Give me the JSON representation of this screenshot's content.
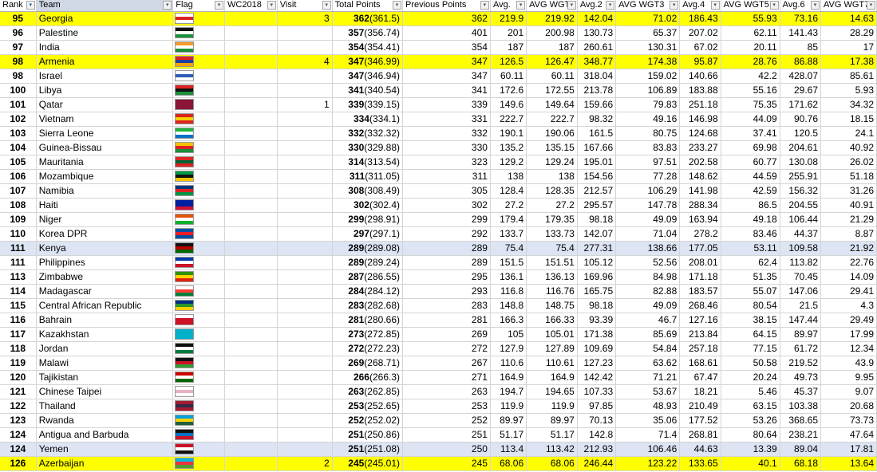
{
  "headers": {
    "rank": "Rank",
    "team": "Team",
    "flag": "Flag",
    "wc2018": "WC2018",
    "visit": "Visit",
    "total": "Total Points",
    "prev": "Previous Points",
    "avg": "Avg.",
    "avg_wgt": "AVG WGT",
    "avg2": "Avg.2",
    "avg_wgt3": "AVG WGT3",
    "avg4": "Avg.4",
    "avg_wgt5": "AVG WGT5",
    "avg6": "Avg.6",
    "avg_wgt7": "AVG WGT7"
  },
  "rows": [
    {
      "rank": "95",
      "team": "Georgia",
      "visit": "3",
      "tp": "362",
      "tpd": "(361.5)",
      "prev": "362",
      "avg": "219.9",
      "avg_wgt": "219.92",
      "avg2": "142.04",
      "avg_wgt3": "71.02",
      "avg4": "186.43",
      "avg_wgt5": "55.93",
      "avg6": "73.16",
      "avg_wgt7": "14.63",
      "style": "hl",
      "flag": [
        "#ffffff",
        "#d22",
        "#ffffff"
      ]
    },
    {
      "rank": "96",
      "team": "Palestine",
      "visit": "",
      "tp": "357",
      "tpd": "(356.74)",
      "prev": "401",
      "avg": "201",
      "avg_wgt": "200.98",
      "avg2": "130.73",
      "avg_wgt3": "65.37",
      "avg4": "207.02",
      "avg_wgt5": "62.11",
      "avg6": "141.43",
      "avg_wgt7": "28.29",
      "style": "",
      "flag": [
        "#111",
        "#fff",
        "#1a8f3a"
      ]
    },
    {
      "rank": "97",
      "team": "India",
      "visit": "",
      "tp": "354",
      "tpd": "(354.41)",
      "prev": "354",
      "avg": "187",
      "avg_wgt": "187",
      "avg2": "260.61",
      "avg_wgt3": "130.31",
      "avg4": "67.02",
      "avg_wgt5": "20.11",
      "avg6": "85",
      "avg_wgt7": "17",
      "style": "",
      "flag": [
        "#f59a2b",
        "#fff",
        "#1a8f3a"
      ]
    },
    {
      "rank": "98",
      "team": "Armenia",
      "visit": "4",
      "tp": "347",
      "tpd": "(346.99)",
      "prev": "347",
      "avg": "126.5",
      "avg_wgt": "126.47",
      "avg2": "348.77",
      "avg_wgt3": "174.38",
      "avg4": "95.87",
      "avg_wgt5": "28.76",
      "avg6": "86.88",
      "avg_wgt7": "17.38",
      "style": "hl",
      "flag": [
        "#d22",
        "#1f3fa0",
        "#f4a300"
      ]
    },
    {
      "rank": "98",
      "team": "Israel",
      "visit": "",
      "tp": "347",
      "tpd": "(346.94)",
      "prev": "347",
      "avg": "60.11",
      "avg_wgt": "60.11",
      "avg2": "318.04",
      "avg_wgt3": "159.02",
      "avg4": "140.66",
      "avg_wgt5": "42.2",
      "avg6": "428.07",
      "avg_wgt7": "85.61",
      "style": "",
      "flag": [
        "#fff",
        "#2d5bb9",
        "#fff"
      ]
    },
    {
      "rank": "100",
      "team": "Libya",
      "visit": "",
      "tp": "341",
      "tpd": "(340.54)",
      "prev": "341",
      "avg": "172.6",
      "avg_wgt": "172.55",
      "avg2": "213.78",
      "avg_wgt3": "106.89",
      "avg4": "183.88",
      "avg_wgt5": "55.16",
      "avg6": "29.67",
      "avg_wgt7": "5.93",
      "style": "",
      "flag": [
        "#d22",
        "#111",
        "#1a8f3a"
      ]
    },
    {
      "rank": "101",
      "team": "Qatar",
      "visit": "1",
      "tp": "339",
      "tpd": "(339.15)",
      "prev": "339",
      "avg": "149.6",
      "avg_wgt": "149.64",
      "avg2": "159.66",
      "avg_wgt3": "79.83",
      "avg4": "251.18",
      "avg_wgt5": "75.35",
      "avg6": "171.62",
      "avg_wgt7": "34.32",
      "style": "",
      "flag": [
        "#8a1538",
        "#8a1538",
        "#8a1538"
      ]
    },
    {
      "rank": "102",
      "team": "Vietnam",
      "visit": "",
      "tp": "334",
      "tpd": "(334.1)",
      "prev": "331",
      "avg": "222.7",
      "avg_wgt": "222.7",
      "avg2": "98.32",
      "avg_wgt3": "49.16",
      "avg4": "146.98",
      "avg_wgt5": "44.09",
      "avg6": "90.76",
      "avg_wgt7": "18.15",
      "style": "",
      "flag": [
        "#da251d",
        "#f5d000",
        "#da251d"
      ]
    },
    {
      "rank": "103",
      "team": "Sierra Leone",
      "visit": "",
      "tp": "332",
      "tpd": "(332.32)",
      "prev": "332",
      "avg": "190.1",
      "avg_wgt": "190.06",
      "avg2": "161.5",
      "avg_wgt3": "80.75",
      "avg4": "124.68",
      "avg_wgt5": "37.41",
      "avg6": "120.5",
      "avg_wgt7": "24.1",
      "style": "",
      "flag": [
        "#1eb53a",
        "#fff",
        "#0072c6"
      ]
    },
    {
      "rank": "104",
      "team": "Guinea-Bissau",
      "visit": "",
      "tp": "330",
      "tpd": "(329.88)",
      "prev": "330",
      "avg": "135.2",
      "avg_wgt": "135.15",
      "avg2": "167.66",
      "avg_wgt3": "83.83",
      "avg4": "233.27",
      "avg_wgt5": "69.98",
      "avg6": "204.61",
      "avg_wgt7": "40.92",
      "style": "",
      "flag": [
        "#f4c300",
        "#d22",
        "#1a8f3a"
      ]
    },
    {
      "rank": "105",
      "team": "Mauritania",
      "visit": "",
      "tp": "314",
      "tpd": "(313.54)",
      "prev": "323",
      "avg": "129.2",
      "avg_wgt": "129.24",
      "avg2": "195.01",
      "avg_wgt3": "97.51",
      "avg4": "202.58",
      "avg_wgt5": "60.77",
      "avg6": "130.08",
      "avg_wgt7": "26.02",
      "style": "",
      "flag": [
        "#d22",
        "#006233",
        "#d22"
      ]
    },
    {
      "rank": "106",
      "team": "Mozambique",
      "visit": "",
      "tp": "311",
      "tpd": "(311.05)",
      "prev": "311",
      "avg": "138",
      "avg_wgt": "138",
      "avg2": "154.56",
      "avg_wgt3": "77.28",
      "avg4": "148.62",
      "avg_wgt5": "44.59",
      "avg6": "255.91",
      "avg_wgt7": "51.18",
      "style": "",
      "flag": [
        "#009a44",
        "#111",
        "#f4c300"
      ]
    },
    {
      "rank": "107",
      "team": "Namibia",
      "visit": "",
      "tp": "308",
      "tpd": "(308.49)",
      "prev": "305",
      "avg": "128.4",
      "avg_wgt": "128.35",
      "avg2": "212.57",
      "avg_wgt3": "106.29",
      "avg4": "141.98",
      "avg_wgt5": "42.59",
      "avg6": "156.32",
      "avg_wgt7": "31.26",
      "style": "",
      "flag": [
        "#003580",
        "#d22",
        "#009543"
      ]
    },
    {
      "rank": "108",
      "team": "Haiti",
      "visit": "",
      "tp": "302",
      "tpd": "(302.4)",
      "prev": "302",
      "avg": "27.2",
      "avg_wgt": "27.2",
      "avg2": "295.57",
      "avg_wgt3": "147.78",
      "avg4": "288.34",
      "avg_wgt5": "86.5",
      "avg6": "204.55",
      "avg_wgt7": "40.91",
      "style": "",
      "flag": [
        "#00209f",
        "#00209f",
        "#d21034"
      ]
    },
    {
      "rank": "109",
      "team": "Niger",
      "visit": "",
      "tp": "299",
      "tpd": "(298.91)",
      "prev": "299",
      "avg": "179.4",
      "avg_wgt": "179.35",
      "avg2": "98.18",
      "avg_wgt3": "49.09",
      "avg4": "163.94",
      "avg_wgt5": "49.18",
      "avg6": "106.44",
      "avg_wgt7": "21.29",
      "style": "",
      "flag": [
        "#e05206",
        "#fff",
        "#0db02b"
      ]
    },
    {
      "rank": "110",
      "team": "Korea DPR",
      "visit": "",
      "tp": "297",
      "tpd": "(297.1)",
      "prev": "292",
      "avg": "133.7",
      "avg_wgt": "133.73",
      "avg2": "142.07",
      "avg_wgt3": "71.04",
      "avg4": "278.2",
      "avg_wgt5": "83.46",
      "avg6": "44.37",
      "avg_wgt7": "8.87",
      "style": "",
      "flag": [
        "#024fa2",
        "#ed1c27",
        "#024fa2"
      ]
    },
    {
      "rank": "111",
      "team": "Kenya",
      "visit": "",
      "tp": "289",
      "tpd": "(289.08)",
      "prev": "289",
      "avg": "75.4",
      "avg_wgt": "75.4",
      "avg2": "277.31",
      "avg_wgt3": "138.66",
      "avg4": "177.05",
      "avg_wgt5": "53.11",
      "avg6": "109.58",
      "avg_wgt7": "21.92",
      "style": "sel",
      "flag": [
        "#111",
        "#bb0000",
        "#006600"
      ]
    },
    {
      "rank": "111",
      "team": "Philippines",
      "visit": "",
      "tp": "289",
      "tpd": "(289.24)",
      "prev": "289",
      "avg": "151.5",
      "avg_wgt": "151.51",
      "avg2": "105.12",
      "avg_wgt3": "52.56",
      "avg4": "208.01",
      "avg_wgt5": "62.4",
      "avg6": "113.82",
      "avg_wgt7": "22.76",
      "style": "",
      "flag": [
        "#0038a8",
        "#fff",
        "#ce1126"
      ]
    },
    {
      "rank": "113",
      "team": "Zimbabwe",
      "visit": "",
      "tp": "287",
      "tpd": "(286.55)",
      "prev": "295",
      "avg": "136.1",
      "avg_wgt": "136.13",
      "avg2": "169.96",
      "avg_wgt3": "84.98",
      "avg4": "171.18",
      "avg_wgt5": "51.35",
      "avg6": "70.45",
      "avg_wgt7": "14.09",
      "style": "",
      "flag": [
        "#319208",
        "#ffd200",
        "#de2010"
      ]
    },
    {
      "rank": "114",
      "team": "Madagascar",
      "visit": "",
      "tp": "284",
      "tpd": "(284.12)",
      "prev": "293",
      "avg": "116.8",
      "avg_wgt": "116.76",
      "avg2": "165.75",
      "avg_wgt3": "82.88",
      "avg4": "183.57",
      "avg_wgt5": "55.07",
      "avg6": "147.06",
      "avg_wgt7": "29.41",
      "style": "",
      "flag": [
        "#fff",
        "#fc3d32",
        "#007e3a"
      ]
    },
    {
      "rank": "115",
      "team": "Central African Republic",
      "visit": "",
      "tp": "283",
      "tpd": "(282.68)",
      "prev": "283",
      "avg": "148.8",
      "avg_wgt": "148.75",
      "avg2": "98.18",
      "avg_wgt3": "49.09",
      "avg4": "268.46",
      "avg_wgt5": "80.54",
      "avg6": "21.5",
      "avg_wgt7": "4.3",
      "style": "",
      "flag": [
        "#003082",
        "#289728",
        "#ffce00"
      ]
    },
    {
      "rank": "116",
      "team": "Bahrain",
      "visit": "",
      "tp": "281",
      "tpd": "(280.66)",
      "prev": "281",
      "avg": "166.3",
      "avg_wgt": "166.33",
      "avg2": "93.39",
      "avg_wgt3": "46.7",
      "avg4": "127.16",
      "avg_wgt5": "38.15",
      "avg6": "147.44",
      "avg_wgt7": "29.49",
      "style": "",
      "flag": [
        "#fff",
        "#ce1126",
        "#ce1126"
      ]
    },
    {
      "rank": "117",
      "team": "Kazakhstan",
      "visit": "",
      "tp": "273",
      "tpd": "(272.85)",
      "prev": "269",
      "avg": "105",
      "avg_wgt": "105.01",
      "avg2": "171.38",
      "avg_wgt3": "85.69",
      "avg4": "213.84",
      "avg_wgt5": "64.15",
      "avg6": "89.97",
      "avg_wgt7": "17.99",
      "style": "",
      "flag": [
        "#00afca",
        "#00afca",
        "#00afca"
      ]
    },
    {
      "rank": "118",
      "team": "Jordan",
      "visit": "",
      "tp": "272",
      "tpd": "(272.23)",
      "prev": "272",
      "avg": "127.9",
      "avg_wgt": "127.89",
      "avg2": "109.69",
      "avg_wgt3": "54.84",
      "avg4": "257.18",
      "avg_wgt5": "77.15",
      "avg6": "61.72",
      "avg_wgt7": "12.34",
      "style": "",
      "flag": [
        "#111",
        "#fff",
        "#007a3d"
      ]
    },
    {
      "rank": "119",
      "team": "Malawi",
      "visit": "",
      "tp": "269",
      "tpd": "(268.71)",
      "prev": "267",
      "avg": "110.6",
      "avg_wgt": "110.61",
      "avg2": "127.23",
      "avg_wgt3": "63.62",
      "avg4": "168.61",
      "avg_wgt5": "50.58",
      "avg6": "219.52",
      "avg_wgt7": "43.9",
      "style": "",
      "flag": [
        "#111",
        "#ce1126",
        "#339e35"
      ]
    },
    {
      "rank": "120",
      "team": "Tajikistan",
      "visit": "",
      "tp": "266",
      "tpd": "(266.3)",
      "prev": "271",
      "avg": "164.9",
      "avg_wgt": "164.9",
      "avg2": "142.42",
      "avg_wgt3": "71.21",
      "avg4": "67.47",
      "avg_wgt5": "20.24",
      "avg6": "49.73",
      "avg_wgt7": "9.95",
      "style": "",
      "flag": [
        "#cc0000",
        "#fff",
        "#006600"
      ]
    },
    {
      "rank": "121",
      "team": "Chinese Taipei",
      "visit": "",
      "tp": "263",
      "tpd": "(262.85)",
      "prev": "263",
      "avg": "194.7",
      "avg_wgt": "194.65",
      "avg2": "107.33",
      "avg_wgt3": "53.67",
      "avg4": "18.21",
      "avg_wgt5": "5.46",
      "avg6": "45.37",
      "avg_wgt7": "9.07",
      "style": "",
      "flag": [
        "#fff",
        "#e8b0c0",
        "#fff"
      ]
    },
    {
      "rank": "122",
      "team": "Thailand",
      "visit": "",
      "tp": "253",
      "tpd": "(252.65)",
      "prev": "253",
      "avg": "119.9",
      "avg_wgt": "119.9",
      "avg2": "97.85",
      "avg_wgt3": "48.93",
      "avg4": "210.49",
      "avg_wgt5": "63.15",
      "avg6": "103.38",
      "avg_wgt7": "20.68",
      "style": "",
      "flag": [
        "#a51931",
        "#2d2a4a",
        "#a51931"
      ]
    },
    {
      "rank": "123",
      "team": "Rwanda",
      "visit": "",
      "tp": "252",
      "tpd": "(252.02)",
      "prev": "252",
      "avg": "89.97",
      "avg_wgt": "89.97",
      "avg2": "70.13",
      "avg_wgt3": "35.06",
      "avg4": "177.52",
      "avg_wgt5": "53.26",
      "avg6": "368.65",
      "avg_wgt7": "73.73",
      "style": "",
      "flag": [
        "#00a1de",
        "#fad201",
        "#20603d"
      ]
    },
    {
      "rank": "124",
      "team": "Antigua and Barbuda",
      "visit": "",
      "tp": "251",
      "tpd": "(250.86)",
      "prev": "251",
      "avg": "51.17",
      "avg_wgt": "51.17",
      "avg2": "142.8",
      "avg_wgt3": "71.4",
      "avg4": "268.81",
      "avg_wgt5": "80.64",
      "avg6": "238.21",
      "avg_wgt7": "47.64",
      "style": "",
      "flag": [
        "#111",
        "#0072c6",
        "#ce1126"
      ]
    },
    {
      "rank": "124",
      "team": "Yemen",
      "visit": "",
      "tp": "251",
      "tpd": "(251.08)",
      "prev": "250",
      "avg": "113.4",
      "avg_wgt": "113.42",
      "avg2": "212.93",
      "avg_wgt3": "106.46",
      "avg4": "44.63",
      "avg_wgt5": "13.39",
      "avg6": "89.04",
      "avg_wgt7": "17.81",
      "style": "sel",
      "flag": [
        "#ce1126",
        "#fff",
        "#111"
      ]
    },
    {
      "rank": "126",
      "team": "Azerbaijan",
      "visit": "2",
      "tp": "245",
      "tpd": "(245.01)",
      "prev": "245",
      "avg": "68.06",
      "avg_wgt": "68.06",
      "avg2": "246.44",
      "avg_wgt3": "123.22",
      "avg4": "133.65",
      "avg_wgt5": "40.1",
      "avg6": "68.18",
      "avg_wgt7": "13.64",
      "style": "hl",
      "flag": [
        "#00b5e2",
        "#ef3340",
        "#509e2f"
      ]
    }
  ]
}
